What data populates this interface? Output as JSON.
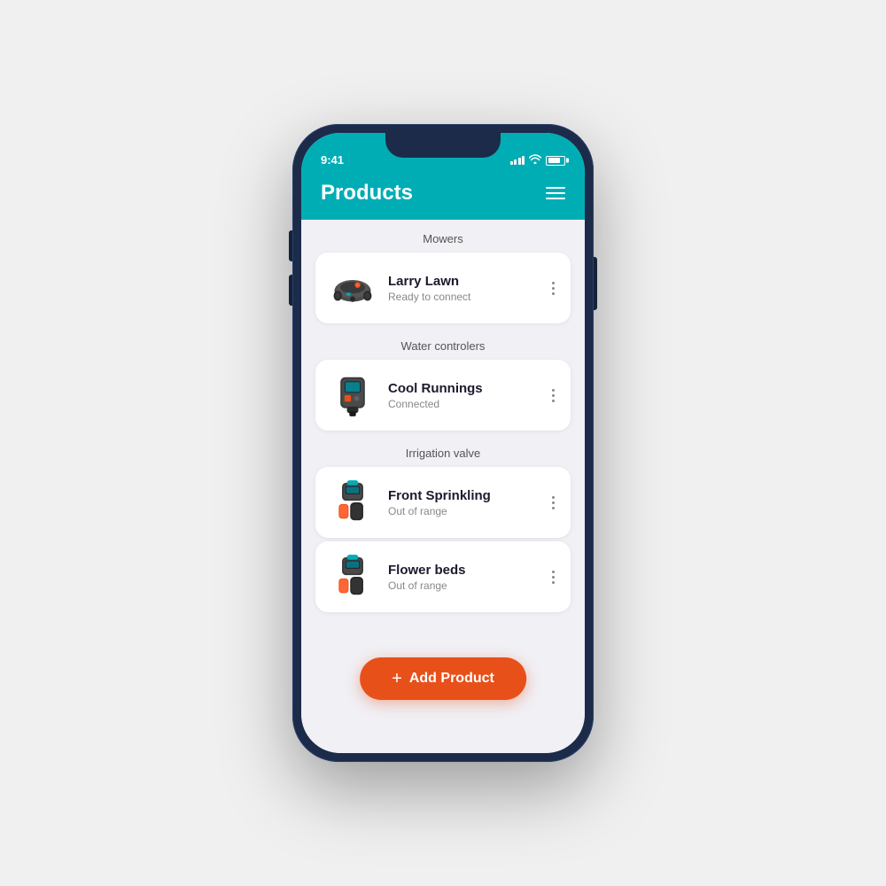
{
  "status_bar": {
    "time": "9:41",
    "signal_alt": "signal",
    "wifi_alt": "wifi",
    "battery_alt": "battery"
  },
  "header": {
    "title": "Products",
    "menu_label": "menu"
  },
  "sections": [
    {
      "label": "Mowers",
      "products": [
        {
          "name": "Larry Lawn",
          "status": "Ready to connect",
          "type": "mower"
        }
      ]
    },
    {
      "label": "Water controlers",
      "products": [
        {
          "name": "Cool Runnings",
          "status": "Connected",
          "type": "water_controller"
        }
      ]
    },
    {
      "label": "Irrigation valve",
      "products": [
        {
          "name": "Front Sprinkling",
          "status": "Out of range",
          "type": "valve"
        },
        {
          "name": "Flower beds",
          "status": "Out of range",
          "type": "valve"
        }
      ]
    }
  ],
  "add_button": {
    "label": "Add Product",
    "icon": "+"
  }
}
